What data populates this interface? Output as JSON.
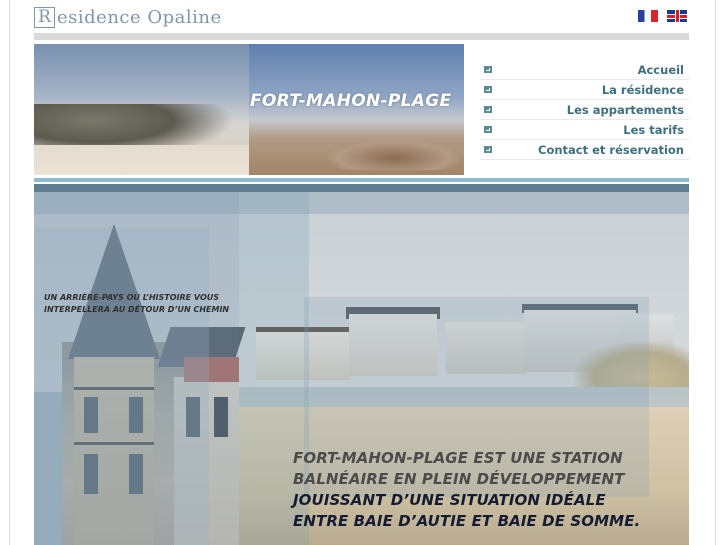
{
  "header": {
    "logo_letter": "R",
    "site_title": "esidence Opaline",
    "languages": [
      {
        "name": "french-flag-icon",
        "code": "fr"
      },
      {
        "name": "uk-flag-icon",
        "code": "en"
      }
    ]
  },
  "banner": {
    "title": "FORT-MAHON-PLAGE"
  },
  "nav": {
    "items": [
      {
        "label": "Accueil"
      },
      {
        "label": "La résidence"
      },
      {
        "label": "Les appartements"
      },
      {
        "label": "Les tarifs"
      },
      {
        "label": "Contact et réservation"
      }
    ]
  },
  "main": {
    "tagline_lines": [
      "UN ARRIÈRE-PAYS OÙ L’HISTOIRE VOUS",
      "INTERPELLERA AU DÉTOUR D’UN CHEMIN"
    ],
    "caption_lines": [
      "FORT-MAHON-PLAGE EST UNE STATION",
      "BALNÉAIRE EN PLEIN DÉVELOPPEMENT",
      "JOUISSANT D’UNE SITUATION IDÉALE",
      "ENTRE BAIE D’AUTIE ET BAIE DE SOMME."
    ]
  },
  "colors": {
    "accent": "#3f6f7e",
    "logo": "#7f97a8",
    "bar_light": "#8fbccc",
    "bar_dark": "#5e7d91"
  }
}
